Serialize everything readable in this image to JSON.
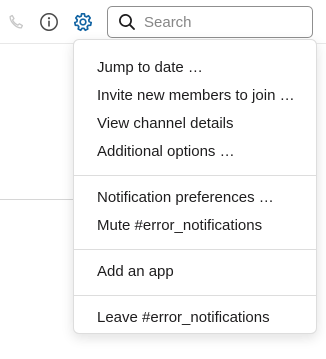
{
  "header": {
    "icons": [
      "phone-icon",
      "info-icon",
      "gear-icon"
    ],
    "accent_color": "#1264a3"
  },
  "search": {
    "placeholder": "Search",
    "value": ""
  },
  "menu": {
    "groups": [
      {
        "items": [
          "Jump to date …",
          "Invite new members to join …",
          "View channel details",
          "Additional options …"
        ]
      },
      {
        "items": [
          "Notification preferences …",
          "Mute #error_notifications"
        ]
      },
      {
        "items": [
          "Add an app"
        ]
      },
      {
        "items": [
          "Leave #error_notifications"
        ]
      }
    ]
  }
}
